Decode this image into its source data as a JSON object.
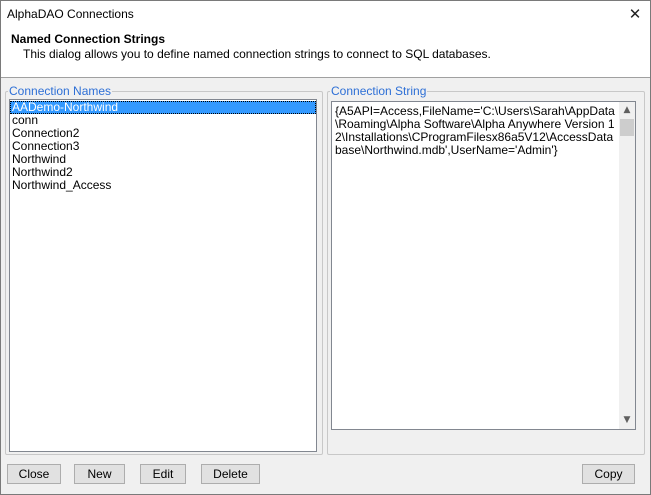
{
  "window": {
    "title": "AlphaDAO Connections"
  },
  "header": {
    "title": "Named Connection Strings",
    "description": "This dialog allows you to define named connection strings to connect to SQL databases."
  },
  "names_panel": {
    "label": "Connection Names",
    "items": [
      "AADemo-Northwind",
      "conn",
      "Connection2",
      "Connection3",
      "Northwind",
      "Northwind2",
      "Northwind_Access"
    ],
    "selected": "AADemo-Northwind"
  },
  "string_panel": {
    "label": "Connection String",
    "value": "{A5API=Access,FileName='C:\\Users\\Sarah\\AppData\\Roaming\\Alpha Software\\Alpha Anywhere Version 12\\Installations\\CProgramFilesx86a5V12\\AccessDatabase\\Northwind.mdb',UserName='Admin'}"
  },
  "buttons": {
    "close": "Close",
    "new": "New",
    "edit": "Edit",
    "delete": "Delete",
    "copy": "Copy"
  },
  "icons": {
    "close": "close-icon",
    "scroll_up": "scroll-up-arrow-icon",
    "scroll_down": "scroll-down-arrow-icon"
  }
}
